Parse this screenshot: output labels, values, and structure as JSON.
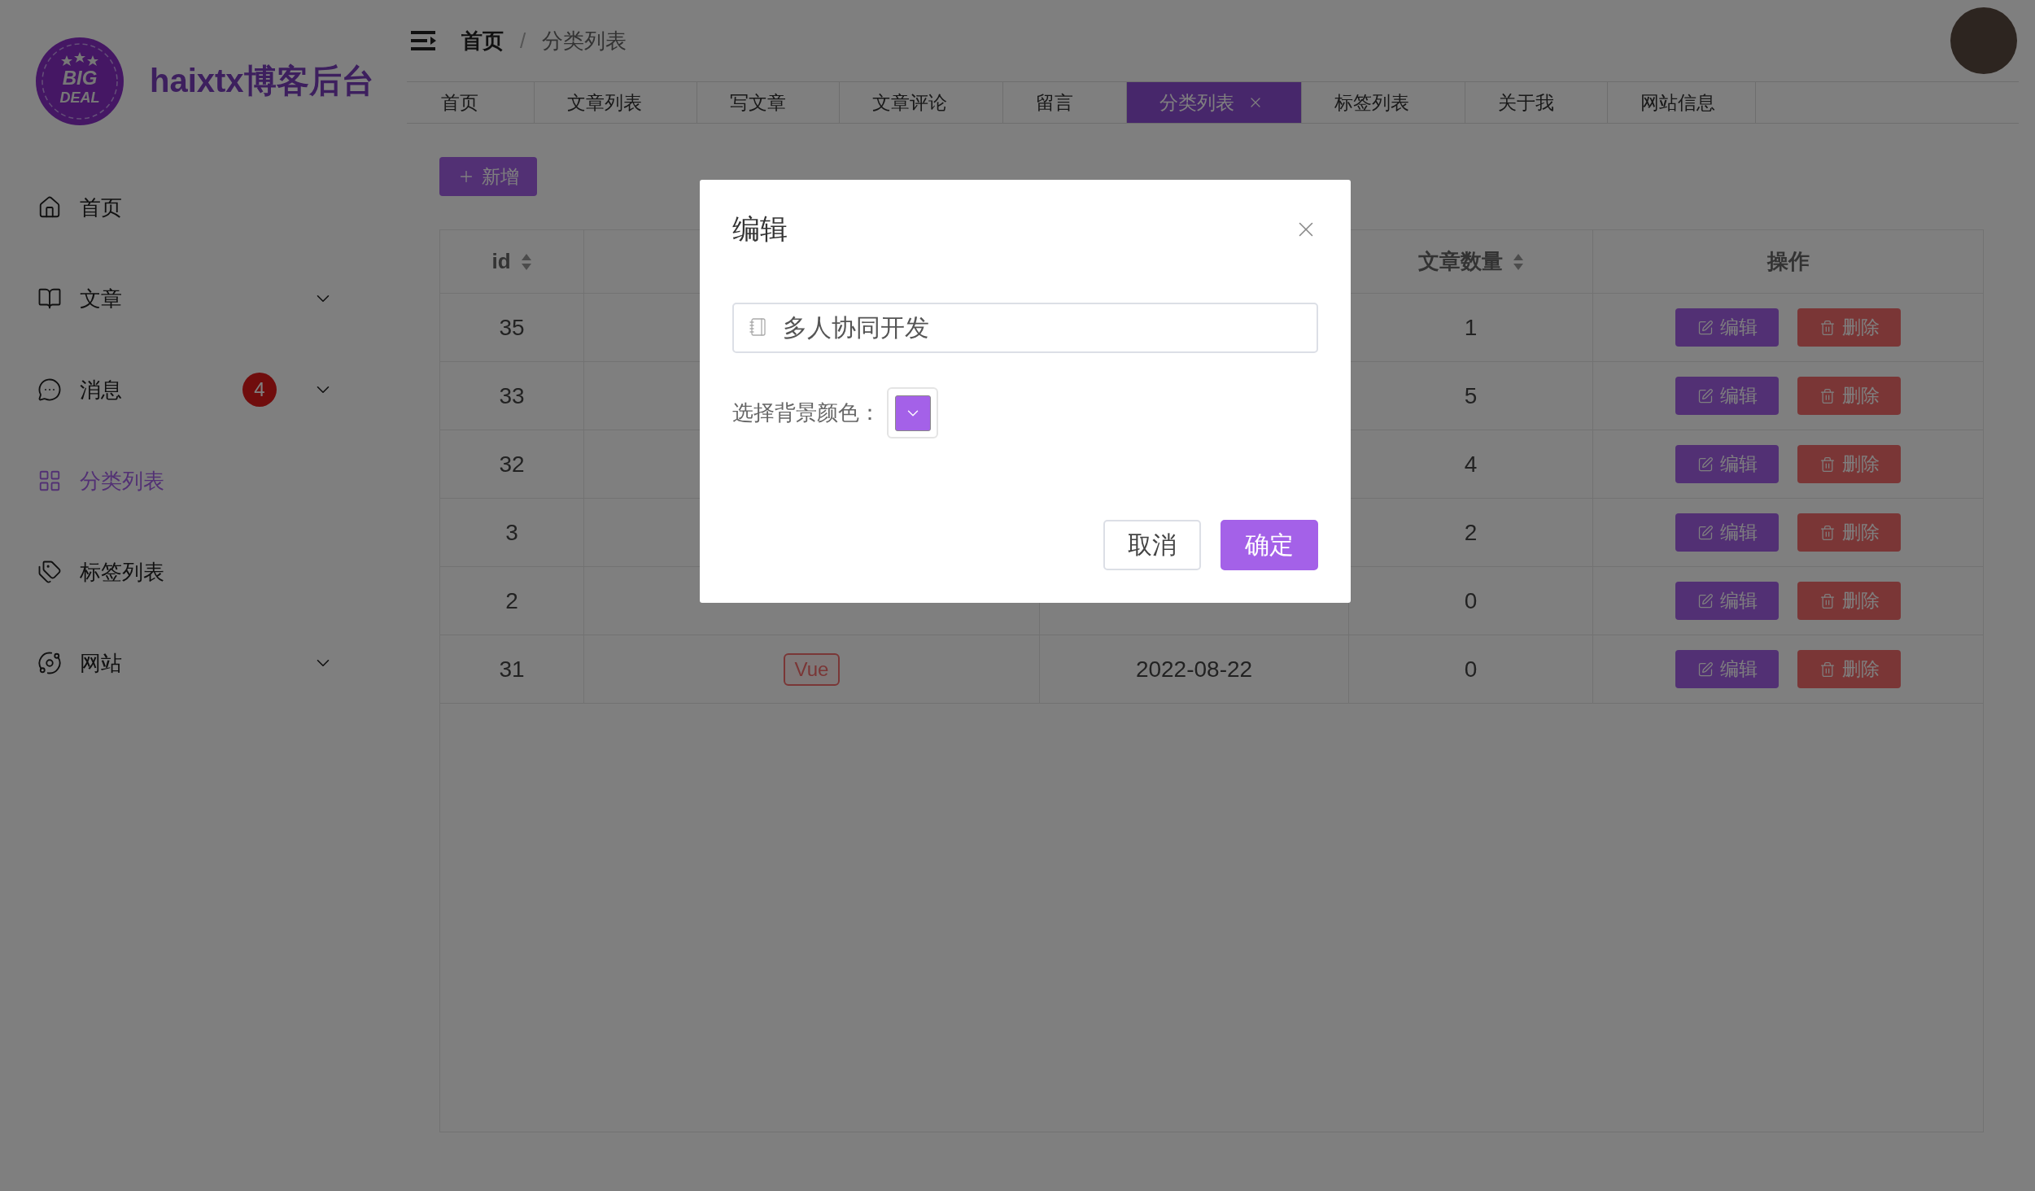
{
  "logo": {
    "badge_lines": [
      "BIG",
      "DEAL"
    ],
    "title": "haixtx博客后台"
  },
  "sidebar": {
    "items": [
      {
        "label": "首页",
        "selected": false,
        "expandable": false
      },
      {
        "label": "文章",
        "selected": false,
        "expandable": true
      },
      {
        "label": "消息",
        "selected": false,
        "expandable": true,
        "badge": "4"
      },
      {
        "label": "分类列表",
        "selected": true,
        "expandable": false
      },
      {
        "label": "标签列表",
        "selected": false,
        "expandable": false
      },
      {
        "label": "网站",
        "selected": false,
        "expandable": true
      }
    ]
  },
  "breadcrumb": {
    "items": [
      "首页",
      "分类列表"
    ],
    "separators": [
      "/"
    ]
  },
  "tabs": [
    {
      "label": "首页",
      "selected": false
    },
    {
      "label": "文章列表",
      "selected": false
    },
    {
      "label": "写文章",
      "selected": false
    },
    {
      "label": "文章评论",
      "selected": false
    },
    {
      "label": "留言",
      "selected": false
    },
    {
      "label": "分类列表",
      "selected": true
    },
    {
      "label": "标签列表",
      "selected": false
    },
    {
      "label": "关于我",
      "selected": false
    },
    {
      "label": "网站信息",
      "selected": false
    }
  ],
  "add_button": "新增",
  "table": {
    "columns": [
      {
        "label": "id",
        "sortable": true
      },
      {
        "label": "文章数量",
        "sortable": true
      },
      {
        "label": "操作",
        "sortable": false
      }
    ],
    "rows": [
      {
        "id": "35",
        "count": "1",
        "edit": "编辑",
        "delete": "删除"
      },
      {
        "id": "33",
        "count": "5",
        "edit": "编辑",
        "delete": "删除"
      },
      {
        "id": "32",
        "count": "4",
        "edit": "编辑",
        "delete": "删除"
      },
      {
        "id": "3",
        "count": "2",
        "edit": "编辑",
        "delete": "删除"
      },
      {
        "id": "2",
        "count": "0",
        "edit": "编辑",
        "delete": "删除"
      },
      {
        "id": "31",
        "tag": {
          "label": "Vue"
        },
        "date": "2022-08-22",
        "count": "0",
        "edit": "编辑",
        "delete": "删除"
      }
    ]
  },
  "dialog": {
    "title": "编辑",
    "name_value": "多人协同开发",
    "color_label": "选择背景颜色：",
    "color": "#a461e8",
    "buttons": [
      {
        "label": "取消",
        "kind": "default"
      },
      {
        "label": "确定",
        "kind": "primary"
      }
    ]
  }
}
